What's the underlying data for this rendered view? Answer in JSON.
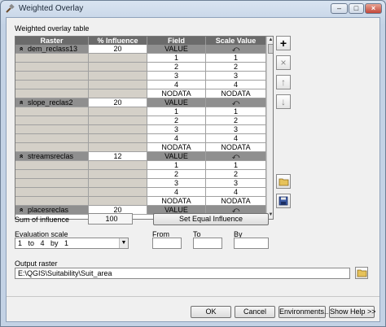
{
  "window": {
    "title": "Weighted Overlay"
  },
  "table": {
    "label": "Weighted overlay table",
    "headers": [
      "Raster",
      "% Influence",
      "Field",
      "Scale Value"
    ],
    "rows": [
      {
        "kind": "raster",
        "raster": "dem_reclass13",
        "influence": "20",
        "field": "VALUE",
        "scale": "⤺"
      },
      {
        "kind": "value",
        "raster": "",
        "influence": "",
        "field": "1",
        "scale": "1"
      },
      {
        "kind": "value",
        "raster": "",
        "influence": "",
        "field": "2",
        "scale": "2"
      },
      {
        "kind": "value",
        "raster": "",
        "influence": "",
        "field": "3",
        "scale": "3"
      },
      {
        "kind": "value",
        "raster": "",
        "influence": "",
        "field": "4",
        "scale": "4"
      },
      {
        "kind": "value",
        "raster": "",
        "influence": "",
        "field": "NODATA",
        "scale": "NODATA"
      },
      {
        "kind": "raster",
        "raster": "slope_reclas2",
        "influence": "20",
        "field": "VALUE",
        "scale": "⤺"
      },
      {
        "kind": "value",
        "raster": "",
        "influence": "",
        "field": "1",
        "scale": "1"
      },
      {
        "kind": "value",
        "raster": "",
        "influence": "",
        "field": "2",
        "scale": "2"
      },
      {
        "kind": "value",
        "raster": "",
        "influence": "",
        "field": "3",
        "scale": "3"
      },
      {
        "kind": "value",
        "raster": "",
        "influence": "",
        "field": "4",
        "scale": "4"
      },
      {
        "kind": "value",
        "raster": "",
        "influence": "",
        "field": "NODATA",
        "scale": "NODATA"
      },
      {
        "kind": "raster",
        "raster": "streamsreclas",
        "influence": "12",
        "field": "VALUE",
        "scale": "⤺"
      },
      {
        "kind": "value",
        "raster": "",
        "influence": "",
        "field": "1",
        "scale": "1"
      },
      {
        "kind": "value",
        "raster": "",
        "influence": "",
        "field": "2",
        "scale": "2"
      },
      {
        "kind": "value",
        "raster": "",
        "influence": "",
        "field": "3",
        "scale": "3"
      },
      {
        "kind": "value",
        "raster": "",
        "influence": "",
        "field": "4",
        "scale": "4"
      },
      {
        "kind": "value",
        "raster": "",
        "influence": "",
        "field": "NODATA",
        "scale": "NODATA"
      },
      {
        "kind": "raster",
        "raster": "placesreclas",
        "influence": "20",
        "field": "VALUE",
        "scale": "⤺"
      }
    ]
  },
  "sum": {
    "label": "Sum of influence",
    "value": "100"
  },
  "set_equal_label": "Set Equal Influence",
  "eval": {
    "label": "Evaluation scale",
    "value": "1   to   4   by   1",
    "from_label": "From",
    "to_label": "To",
    "by_label": "By"
  },
  "output": {
    "label": "Output raster",
    "value": "E:\\QGIS\\Suitability\\Suit_area"
  },
  "buttons": {
    "ok": "OK",
    "cancel": "Cancel",
    "env": "Environments...",
    "help": "Show Help >>"
  },
  "side_icons": {
    "add": "+",
    "remove": "×",
    "up": "↑",
    "down": "↓"
  }
}
